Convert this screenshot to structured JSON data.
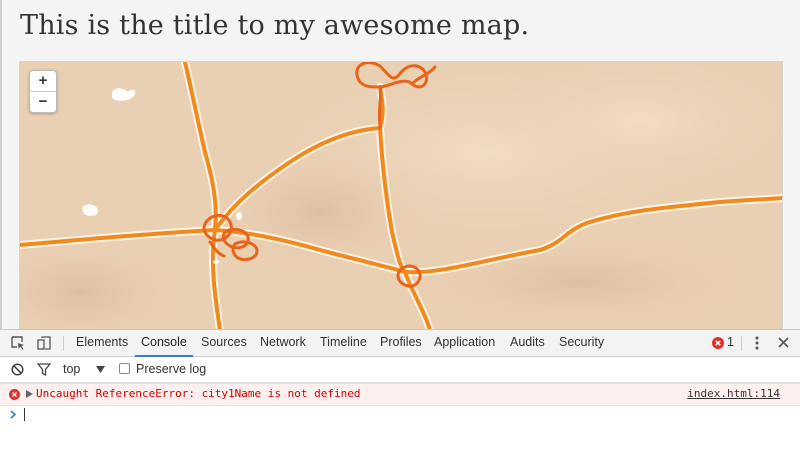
{
  "page": {
    "title": "This is the title to my awesome map."
  },
  "map": {
    "zoom_in_label": "+",
    "zoom_out_label": "−",
    "colors": {
      "background": "#ead0b3",
      "road": "#f08a1c",
      "road_casing": "#fff6ec"
    }
  },
  "devtools": {
    "tabs": [
      "Elements",
      "Console",
      "Sources",
      "Network",
      "Timeline",
      "Profiles",
      "Application",
      "Audits",
      "Security"
    ],
    "active_tab": "Console",
    "error_count": "1",
    "toolbar": {
      "context": "top",
      "preserve_log_label": "Preserve log",
      "preserve_log_checked": false
    },
    "console": {
      "messages": [
        {
          "level": "error",
          "text": "Uncaught ReferenceError: city1Name is not defined",
          "source": "index.html:114"
        }
      ]
    },
    "colors": {
      "active_tab_underline": "#3879d9",
      "error_text": "#d40000",
      "error_bg": "#fff0f0",
      "prompt": "#3879d9"
    },
    "icons": [
      "inspect-element-icon",
      "device-toolbar-icon",
      "error-icon",
      "more-vert-icon",
      "close-icon",
      "clear-console-icon",
      "filter-icon",
      "dropdown-arrow-icon",
      "expand-arrow-icon",
      "prompt-chevron-icon"
    ]
  }
}
